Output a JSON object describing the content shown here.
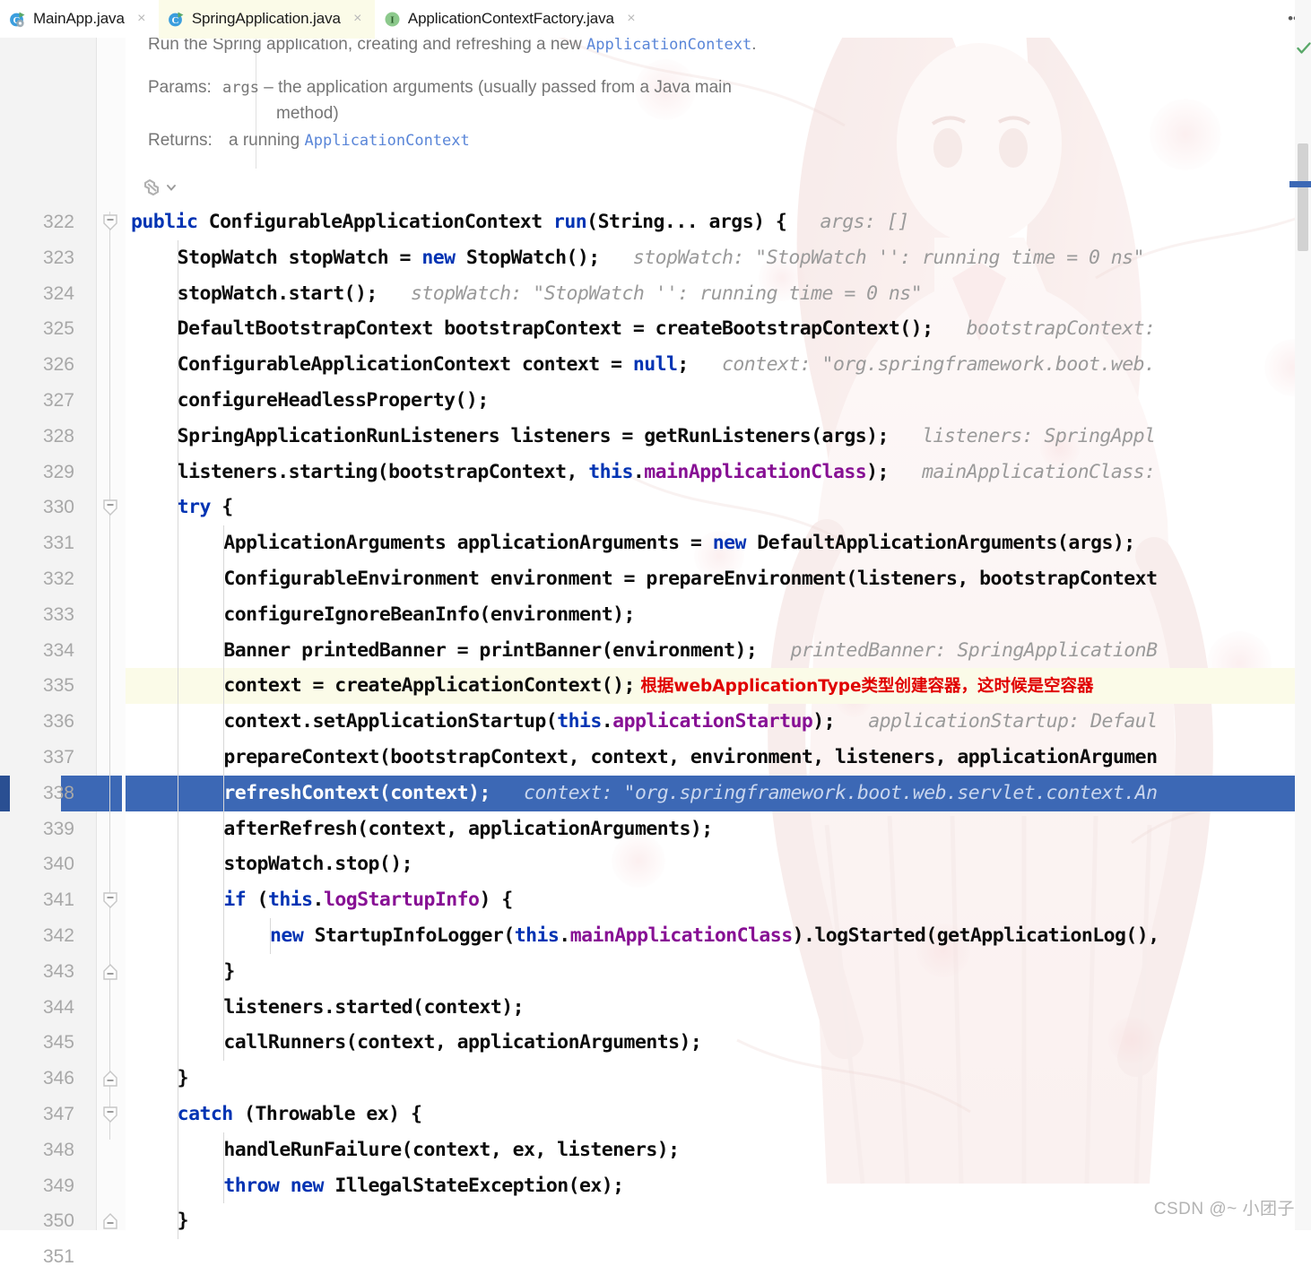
{
  "window": {
    "app": "IntelliJ IDEA",
    "more_icon": "kebab-menu-icon"
  },
  "tabs": [
    {
      "label": "MainApp.java",
      "icon": "java-class-run-icon",
      "close": "×",
      "active": false
    },
    {
      "label": "SpringApplication.java",
      "icon": "java-class-icon",
      "close": "×",
      "active": true
    },
    {
      "label": "ApplicationContextFactory.java",
      "icon": "java-interface-icon",
      "close": "×",
      "active": false
    }
  ],
  "doc_popup": {
    "summary_prefix": "Run the Spring application, creating and refreshing a new ",
    "summary_link": "ApplicationContext",
    "summary_suffix": ".",
    "params_label": "Params:",
    "params_name": "args",
    "params_dash": "–",
    "params_text_line1": "the application arguments (usually passed from a Java main",
    "params_text_line2": "method)",
    "returns_label": "Returns:",
    "returns_text": "a running ",
    "returns_link": "ApplicationContext",
    "spring_icon": "spring-bean-icon",
    "spring_chevron": "chevron-down-icon"
  },
  "editor": {
    "highlight_yellow_line": 335,
    "highlight_blue_line": 338,
    "colors": {
      "keyword": "#0033b3",
      "field": "#871094",
      "inlay_hint": "#9a9a9a",
      "comment_cn": "#e00000",
      "selection": "#3c68b5",
      "current_line": "#fbfbe8",
      "gutter_bg": "#f3f3f3",
      "line_number": "#a8a8a8"
    },
    "lines": [
      {
        "n": 322,
        "indent": 0,
        "fold": "minus",
        "parts": [
          {
            "t": "public ",
            "c": "kw"
          },
          {
            "t": "ConfigurableApplicationContext ",
            "c": ""
          },
          {
            "t": "run",
            "c": "kw"
          },
          {
            "t": "(String... args) {",
            "c": ""
          },
          {
            "t": "   args: []",
            "c": "hint"
          }
        ]
      },
      {
        "n": 323,
        "indent": 1,
        "parts": [
          {
            "t": "StopWatch stopWatch = ",
            "c": ""
          },
          {
            "t": "new",
            "c": "kw"
          },
          {
            "t": " StopWatch();",
            "c": ""
          },
          {
            "t": "   stopWatch: \"StopWatch '': running time = 0 ns\"",
            "c": "hint"
          }
        ]
      },
      {
        "n": 324,
        "indent": 1,
        "parts": [
          {
            "t": "stopWatch.start();",
            "c": ""
          },
          {
            "t": "   stopWatch: \"StopWatch '': running time = 0 ns\"",
            "c": "hint"
          }
        ]
      },
      {
        "n": 325,
        "indent": 1,
        "parts": [
          {
            "t": "DefaultBootstrapContext bootstrapContext = createBootstrapContext();",
            "c": ""
          },
          {
            "t": "   bootstrapContext:",
            "c": "hint"
          }
        ]
      },
      {
        "n": 326,
        "indent": 1,
        "parts": [
          {
            "t": "ConfigurableApplicationContext context = ",
            "c": ""
          },
          {
            "t": "null",
            "c": "kw"
          },
          {
            "t": ";",
            "c": ""
          },
          {
            "t": "   context: \"org.springframework.boot.web.",
            "c": "hint"
          }
        ]
      },
      {
        "n": 327,
        "indent": 1,
        "parts": [
          {
            "t": "configureHeadlessProperty();",
            "c": ""
          }
        ]
      },
      {
        "n": 328,
        "indent": 1,
        "parts": [
          {
            "t": "SpringApplicationRunListeners listeners = getRunListeners(args);",
            "c": ""
          },
          {
            "t": "   listeners: SpringAppl",
            "c": "hint"
          }
        ]
      },
      {
        "n": 329,
        "indent": 1,
        "parts": [
          {
            "t": "listeners.starting(bootstrapContext, ",
            "c": ""
          },
          {
            "t": "this",
            "c": "kw"
          },
          {
            "t": ".",
            "c": ""
          },
          {
            "t": "mainApplicationClass",
            "c": "fld"
          },
          {
            "t": ");",
            "c": ""
          },
          {
            "t": "   mainApplicationClass:",
            "c": "hint"
          }
        ]
      },
      {
        "n": 330,
        "indent": 1,
        "fold": "minus",
        "parts": [
          {
            "t": "try",
            "c": "kw"
          },
          {
            "t": " {",
            "c": ""
          }
        ]
      },
      {
        "n": 331,
        "indent": 2,
        "parts": [
          {
            "t": "ApplicationArguments applicationArguments = ",
            "c": ""
          },
          {
            "t": "new",
            "c": "kw"
          },
          {
            "t": " DefaultApplicationArguments(args);",
            "c": ""
          }
        ]
      },
      {
        "n": 332,
        "indent": 2,
        "parts": [
          {
            "t": "ConfigurableEnvironment environment = prepareEnvironment(listeners, bootstrapContext",
            "c": ""
          }
        ]
      },
      {
        "n": 333,
        "indent": 2,
        "parts": [
          {
            "t": "configureIgnoreBeanInfo(environment);",
            "c": ""
          }
        ]
      },
      {
        "n": 334,
        "indent": 2,
        "parts": [
          {
            "t": "Banner printedBanner = printBanner(environment);",
            "c": ""
          },
          {
            "t": "   printedBanner: SpringApplicationB",
            "c": "hint"
          }
        ]
      },
      {
        "n": 335,
        "indent": 2,
        "hl": "yellow",
        "parts": [
          {
            "t": "context = createApplicationContext();",
            "c": ""
          },
          {
            "t": " 根据webApplicationType类型创建容器，这时候是空容器",
            "c": "cn-comment"
          }
        ]
      },
      {
        "n": 336,
        "indent": 2,
        "parts": [
          {
            "t": "context.setApplicationStartup(",
            "c": ""
          },
          {
            "t": "this",
            "c": "kw"
          },
          {
            "t": ".",
            "c": ""
          },
          {
            "t": "applicationStartup",
            "c": "fld"
          },
          {
            "t": ");",
            "c": ""
          },
          {
            "t": "   applicationStartup: Defaul",
            "c": "hint"
          }
        ]
      },
      {
        "n": 337,
        "indent": 2,
        "parts": [
          {
            "t": "prepareContext(bootstrapContext, context, environment, listeners, applicationArgumen",
            "c": ""
          }
        ]
      },
      {
        "n": 338,
        "indent": 2,
        "hl": "blue",
        "parts": [
          {
            "t": "refreshContext(context);",
            "c": ""
          },
          {
            "t": "   context: \"org.springframework.boot.web.servlet.context.An",
            "c": "hint"
          }
        ]
      },
      {
        "n": 339,
        "indent": 2,
        "parts": [
          {
            "t": "afterRefresh(context, applicationArguments);",
            "c": ""
          }
        ]
      },
      {
        "n": 340,
        "indent": 2,
        "parts": [
          {
            "t": "stopWatch.stop();",
            "c": ""
          }
        ]
      },
      {
        "n": 341,
        "indent": 2,
        "fold": "minus",
        "parts": [
          {
            "t": "if",
            "c": "kw"
          },
          {
            "t": " (",
            "c": ""
          },
          {
            "t": "this",
            "c": "kw"
          },
          {
            "t": ".",
            "c": ""
          },
          {
            "t": "logStartupInfo",
            "c": "fld"
          },
          {
            "t": ") {",
            "c": ""
          }
        ]
      },
      {
        "n": 342,
        "indent": 3,
        "parts": [
          {
            "t": "new",
            "c": "kw"
          },
          {
            "t": " StartupInfoLogger(",
            "c": ""
          },
          {
            "t": "this",
            "c": "kw"
          },
          {
            "t": ".",
            "c": ""
          },
          {
            "t": "mainApplicationClass",
            "c": "fld"
          },
          {
            "t": ").logStarted(getApplicationLog(),",
            "c": ""
          }
        ]
      },
      {
        "n": 343,
        "indent": 2,
        "fold": "plus",
        "parts": [
          {
            "t": "}",
            "c": ""
          }
        ]
      },
      {
        "n": 344,
        "indent": 2,
        "parts": [
          {
            "t": "listeners.started(context);",
            "c": ""
          }
        ]
      },
      {
        "n": 345,
        "indent": 2,
        "parts": [
          {
            "t": "callRunners(context, applicationArguments);",
            "c": ""
          }
        ]
      },
      {
        "n": 346,
        "indent": 1,
        "fold": "plus",
        "parts": [
          {
            "t": "}",
            "c": ""
          }
        ]
      },
      {
        "n": 347,
        "indent": 1,
        "fold": "minus",
        "parts": [
          {
            "t": "catch",
            "c": "kw"
          },
          {
            "t": " (Throwable ex) {",
            "c": ""
          }
        ]
      },
      {
        "n": 348,
        "indent": 2,
        "parts": [
          {
            "t": "handleRunFailure(context, ex, listeners);",
            "c": ""
          }
        ]
      },
      {
        "n": 349,
        "indent": 2,
        "parts": [
          {
            "t": "throw",
            "c": "kw"
          },
          {
            "t": " ",
            "c": ""
          },
          {
            "t": "new",
            "c": "kw"
          },
          {
            "t": " IllegalStateException(ex);",
            "c": ""
          }
        ]
      },
      {
        "n": 350,
        "indent": 1,
        "fold": "plus",
        "parts": [
          {
            "t": "}",
            "c": ""
          }
        ]
      },
      {
        "n": 351,
        "indent": 1,
        "parts": []
      }
    ]
  },
  "right_gutter": {
    "inspection_icon": "inspection-ok-checkmark-icon",
    "scrollbar": "vertical-scrollbar",
    "marker": "selection-marker"
  },
  "watermark": {
    "text": "CSDN @~ 小团子"
  }
}
